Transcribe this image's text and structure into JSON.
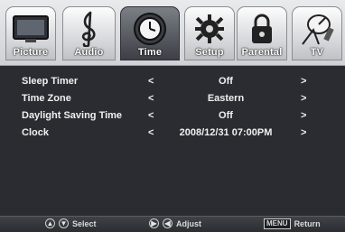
{
  "tabs": [
    {
      "label": "Picture",
      "icon": "tv-icon"
    },
    {
      "label": "Audio",
      "icon": "treble-clef-icon"
    },
    {
      "label": "Time",
      "icon": "clock-icon"
    },
    {
      "label": "Setup",
      "icon": "gear-icon"
    },
    {
      "label": "Parental",
      "icon": "padlock-icon"
    },
    {
      "label": "TV",
      "icon": "satellite-dish-icon"
    }
  ],
  "active_tab": "Time",
  "menu": [
    {
      "name": "Sleep Timer",
      "left": "<",
      "value": "Off",
      "right": ">"
    },
    {
      "name": "Time Zone",
      "left": "<",
      "value": "Eastern",
      "right": ">"
    },
    {
      "name": "Daylight Saving Time",
      "left": "<",
      "value": "Off",
      "right": ">"
    },
    {
      "name": "Clock",
      "left": "<",
      "value": "2008/12/31  07:00PM",
      "right": ">"
    }
  ],
  "hints": {
    "select_label": "Select",
    "adjust_label": "Adjust",
    "menu_key": "MENU",
    "return_label": "Return"
  }
}
